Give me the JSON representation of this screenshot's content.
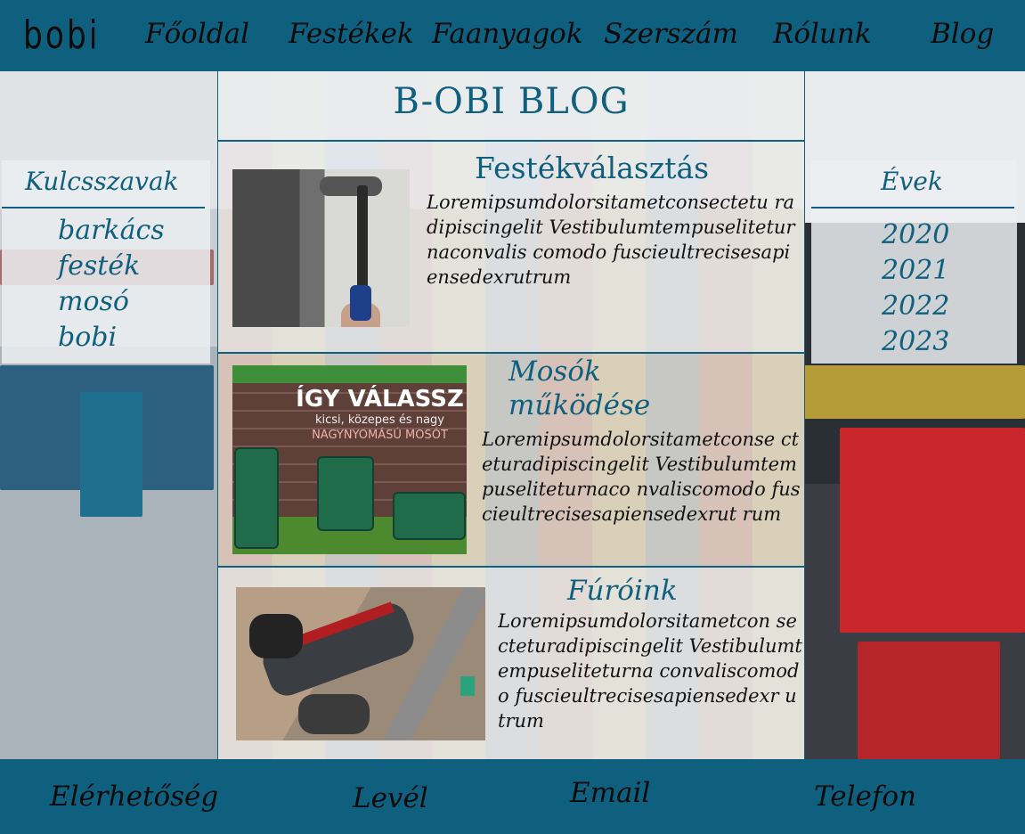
{
  "header": {
    "logo": "bobi",
    "nav": [
      "Főoldal",
      "Festékek",
      "Faanyagok",
      "Szerszám",
      "Rólunk",
      "Blog"
    ]
  },
  "blog": {
    "title": "B-OBI BLOG",
    "articles": [
      {
        "title": "Festékválasztás",
        "body": "Loremipsumdolorsitametconsectetu radipiscingelit Vestibulumtempuseliteturnaconvalis comodo fuscieultrecisesapiensedexrutrum",
        "image_alt": "paint-roller-photo"
      },
      {
        "title_line1": "Mosók",
        "title_line2": "működése",
        "body": "Loremipsumdolorsitametconse cteturadipiscingelit Vestibulumtempuseliteturnaco nvaliscomodo fuscieultrecisesapiensedexrut rum",
        "image_text": {
          "headline": "ÍGY VÁLASSZ",
          "sub": "kicsi, közepes és nagy",
          "sub2": "NAGYNYOMÁSÚ MOSÓT"
        }
      },
      {
        "title": "Fúróink",
        "body": "Loremipsumdolorsitametcon secteturadipiscingelit Vestibulumtempuseliteturna convaliscomodo fuscieultrecisesapiensedexr utrum",
        "image_alt": "drill-photo"
      }
    ]
  },
  "keywords": {
    "title": "Kulcsszavak",
    "items": [
      "barkács",
      "festék",
      "mosó",
      "bobi"
    ]
  },
  "years": {
    "title": "Évek",
    "items": [
      "2020",
      "2021",
      "2022",
      "2023"
    ]
  },
  "footer": {
    "items": [
      "Elérhetőség",
      "Levél",
      "Email",
      "Telefon"
    ]
  },
  "colors": {
    "brand": "#0f5f7e",
    "text": "#0b0b0b"
  }
}
